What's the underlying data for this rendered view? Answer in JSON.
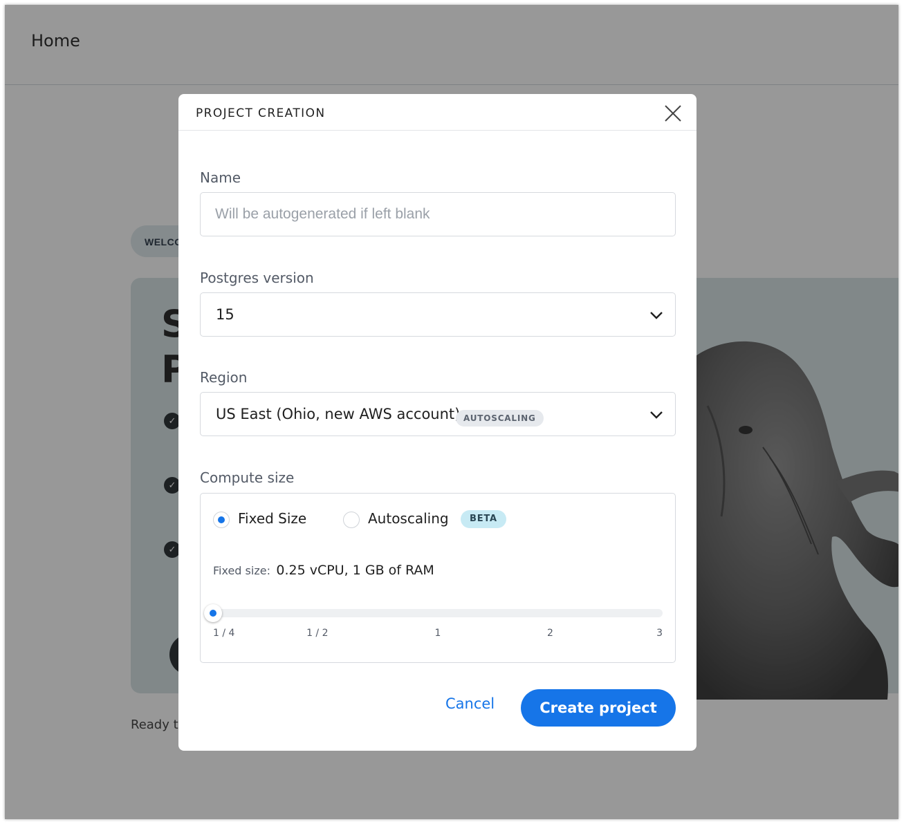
{
  "page": {
    "title": "Home",
    "welcome_badge": "WELCO",
    "hero_heading_line1": "S",
    "hero_heading_line2": "P",
    "ready_text": "Ready to"
  },
  "modal": {
    "title": "PROJECT CREATION",
    "name": {
      "label": "Name",
      "value": "",
      "placeholder": "Will be autogenerated if left blank"
    },
    "postgres_version": {
      "label": "Postgres version",
      "selected": "15"
    },
    "region": {
      "label": "Region",
      "selected": "US East (Ohio, new AWS account)",
      "badge": "AUTOSCALING"
    },
    "compute": {
      "label": "Compute size",
      "options": [
        {
          "label": "Fixed Size",
          "selected": true
        },
        {
          "label": "Autoscaling",
          "selected": false,
          "badge": "BETA"
        }
      ],
      "fixed_size_key": "Fixed size:",
      "fixed_size_value": "0.25 vCPU, 1 GB of RAM",
      "slider_ticks": [
        "1 / 4",
        "1 / 2",
        "1",
        "2",
        "3"
      ],
      "slider_selected_index": 0
    },
    "cancel_label": "Cancel",
    "create_label": "Create project"
  },
  "colors": {
    "accent": "#1675e8",
    "overlay": "rgba(30,30,30,0.46)",
    "beta_badge_bg": "#c7eaf4",
    "hero_bg": "#d4e1e4"
  },
  "icons": {
    "close": "close-icon",
    "chevron": "chevron-down-icon",
    "check": "check-circle-icon"
  }
}
